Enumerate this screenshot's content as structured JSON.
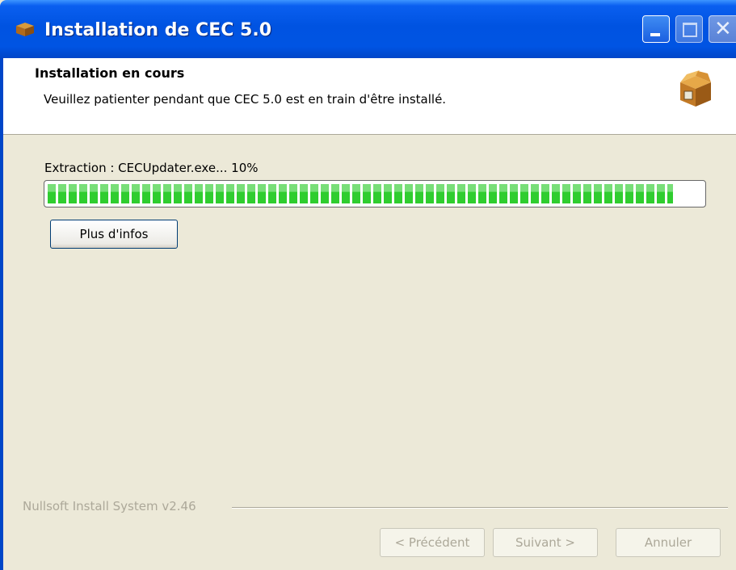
{
  "window": {
    "title": "Installation de CEC 5.0",
    "controls": [
      "minimize",
      "maximize",
      "close"
    ]
  },
  "header": {
    "title": "Installation en cours",
    "subtitle": "Veuillez patienter pendant que CEC 5.0 est en train d'être installé.",
    "icon": "box-icon"
  },
  "progress": {
    "status_text": "Extraction : CECUpdater.exe... 10%",
    "fraction": 0.955,
    "color": "#2fcd2f"
  },
  "buttons": {
    "details": "Plus d'infos",
    "back": "< Précédent",
    "next": "Suivant >",
    "cancel": "Annuler"
  },
  "branding": "Nullsoft Install System v2.46"
}
